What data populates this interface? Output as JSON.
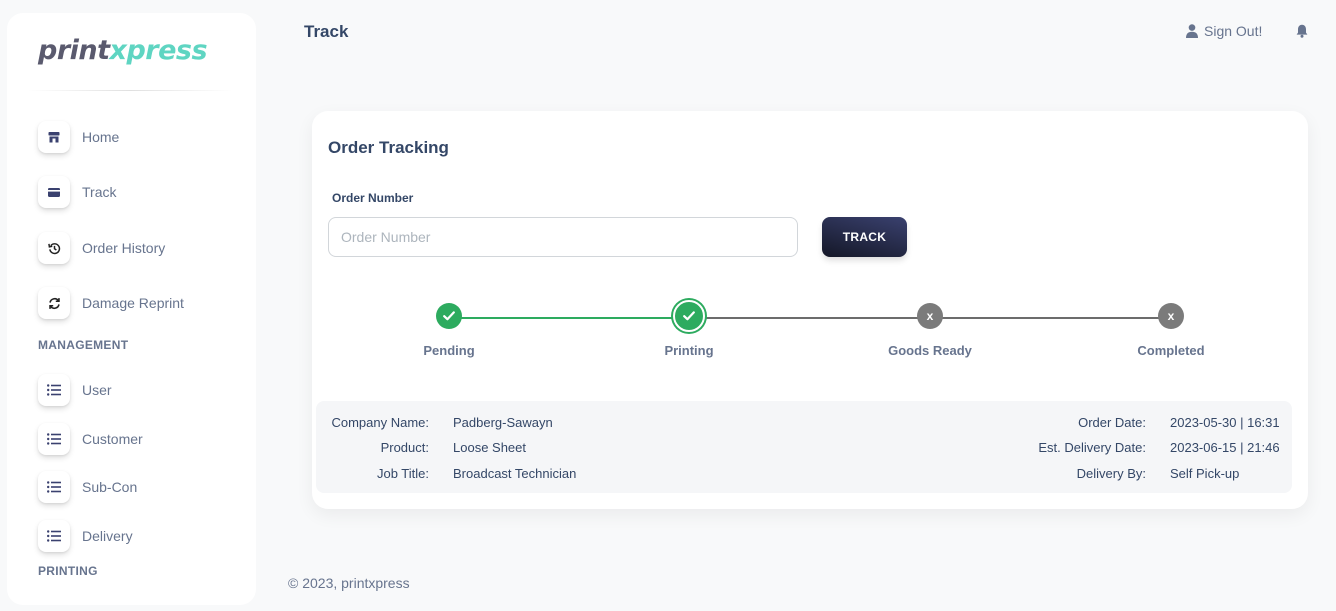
{
  "brand": {
    "part1": "print",
    "part2": "xpress"
  },
  "sidebar": {
    "items": [
      {
        "label": "Home"
      },
      {
        "label": "Track"
      },
      {
        "label": "Order History"
      },
      {
        "label": "Damage Reprint"
      }
    ],
    "section_management": "MANAGEMENT",
    "management_items": [
      {
        "label": "User"
      },
      {
        "label": "Customer"
      },
      {
        "label": "Sub-Con"
      },
      {
        "label": "Delivery"
      }
    ],
    "section_printing": "PRINTING"
  },
  "header": {
    "title": "Track",
    "signout_label": "Sign Out!"
  },
  "card": {
    "title": "Order Tracking",
    "field_label": "Order Number",
    "input_placeholder": "Order Number",
    "input_value": "",
    "track_label": "TRACK"
  },
  "steps": [
    {
      "label": "Pending",
      "status": "done"
    },
    {
      "label": "Printing",
      "status": "current"
    },
    {
      "label": "Goods Ready",
      "status": "todo",
      "mark": "x"
    },
    {
      "label": "Completed",
      "status": "todo",
      "mark": "x"
    }
  ],
  "details": {
    "left": [
      {
        "label": "Company Name:",
        "value": "Padberg-Sawayn"
      },
      {
        "label": "Product:",
        "value": "Loose Sheet"
      },
      {
        "label": "Job Title:",
        "value": "Broadcast Technician"
      }
    ],
    "right": [
      {
        "label": "Order Date:",
        "value": "2023-05-30 | 16:31"
      },
      {
        "label": "Est. Delivery Date:",
        "value": "2023-06-15 | 21:46"
      },
      {
        "label": "Delivery By:",
        "value": "Self Pick-up"
      }
    ]
  },
  "footer": {
    "text": "© 2023, printxpress"
  },
  "colors": {
    "success": "#2dab5f",
    "pending": "#7b7b7b",
    "button": "#141727",
    "accent_logo": "#5fd5c2"
  }
}
